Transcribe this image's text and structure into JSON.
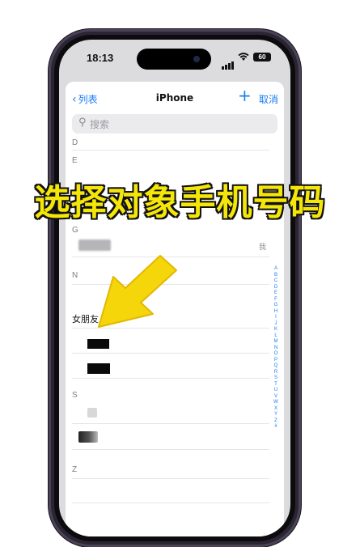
{
  "status_bar": {
    "time": "18:13",
    "battery": "60"
  },
  "nav": {
    "back_label": "列表",
    "title": "iPhone",
    "add": "+",
    "cancel_label": "取消"
  },
  "search": {
    "placeholder": "搜索"
  },
  "sections": [
    {
      "letter": "D"
    },
    {
      "letter": "E"
    },
    {
      "letter": "G",
      "my_card_tag": "我"
    },
    {
      "letter": "N",
      "contact": "女朋友"
    },
    {
      "letter": "S"
    },
    {
      "letter": "Z"
    }
  ],
  "alphabet_index": [
    "A",
    "B",
    "C",
    "D",
    "E",
    "F",
    "G",
    "H",
    "I",
    "J",
    "K",
    "L",
    "M",
    "N",
    "O",
    "P",
    "Q",
    "R",
    "S",
    "T",
    "U",
    "V",
    "W",
    "X",
    "Y",
    "Z",
    "#"
  ],
  "overlay": {
    "title": "选择对象手机号码"
  },
  "colors": {
    "accent": "#1a7cf5",
    "overlay_text": "#f5e60a",
    "arrow": "#f5d60a"
  }
}
